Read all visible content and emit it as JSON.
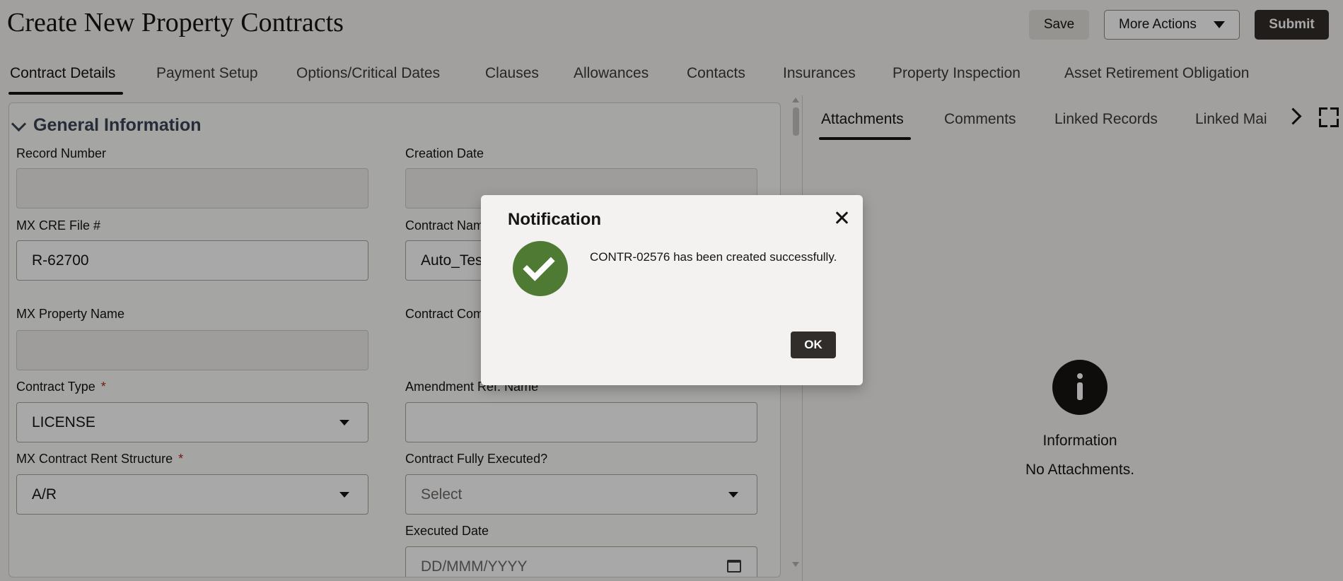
{
  "page": {
    "title": "Create New Property Contracts"
  },
  "header": {
    "save_label": "Save",
    "more_actions_label": "More Actions",
    "submit_label": "Submit"
  },
  "tabs": [
    {
      "label": "Contract Details",
      "active": true
    },
    {
      "label": "Payment Setup"
    },
    {
      "label": "Options/Critical Dates"
    },
    {
      "label": "Clauses"
    },
    {
      "label": "Allowances"
    },
    {
      "label": "Contacts"
    },
    {
      "label": "Insurances"
    },
    {
      "label": "Property Inspection"
    },
    {
      "label": "Asset Retirement Obligation"
    }
  ],
  "section": {
    "title": "General Information"
  },
  "fields": {
    "record_number": {
      "label": "Record Number",
      "value": ""
    },
    "creation_date": {
      "label": "Creation Date",
      "value": ""
    },
    "cre_file": {
      "label": "MX CRE File #",
      "value": "R-62700"
    },
    "contract_name": {
      "label": "Contract Name",
      "value": "Auto_Test7"
    },
    "property_name": {
      "label": "MX Property Name",
      "value": ""
    },
    "contract_complexity": {
      "label": "Contract Complexity"
    },
    "contract_type": {
      "label": "Contract Type",
      "required": "*",
      "value": "LICENSE"
    },
    "amendment_ref": {
      "label": "Amendment Ref. Name",
      "value": ""
    },
    "rent_structure": {
      "label": "MX Contract Rent Structure",
      "required": "*",
      "value": "A/R"
    },
    "fully_executed": {
      "label": "Contract Fully Executed?",
      "value": "Select"
    },
    "executed_date": {
      "label": "Executed Date",
      "placeholder": "DD/MMM/YYYY"
    }
  },
  "right_panel": {
    "tabs": [
      {
        "label": "Attachments",
        "active": true
      },
      {
        "label": "Comments"
      },
      {
        "label": "Linked Records"
      },
      {
        "label": "Linked Mai"
      }
    ],
    "info_title": "Information",
    "info_text": "No Attachments."
  },
  "dialog": {
    "title": "Notification",
    "message": "CONTR-02576 has been created successfully.",
    "ok_label": "OK"
  },
  "colors": {
    "success": "#4e7a33",
    "dark_button": "#312d2a",
    "required": "#b3261e",
    "section_title": "#3a4555"
  }
}
